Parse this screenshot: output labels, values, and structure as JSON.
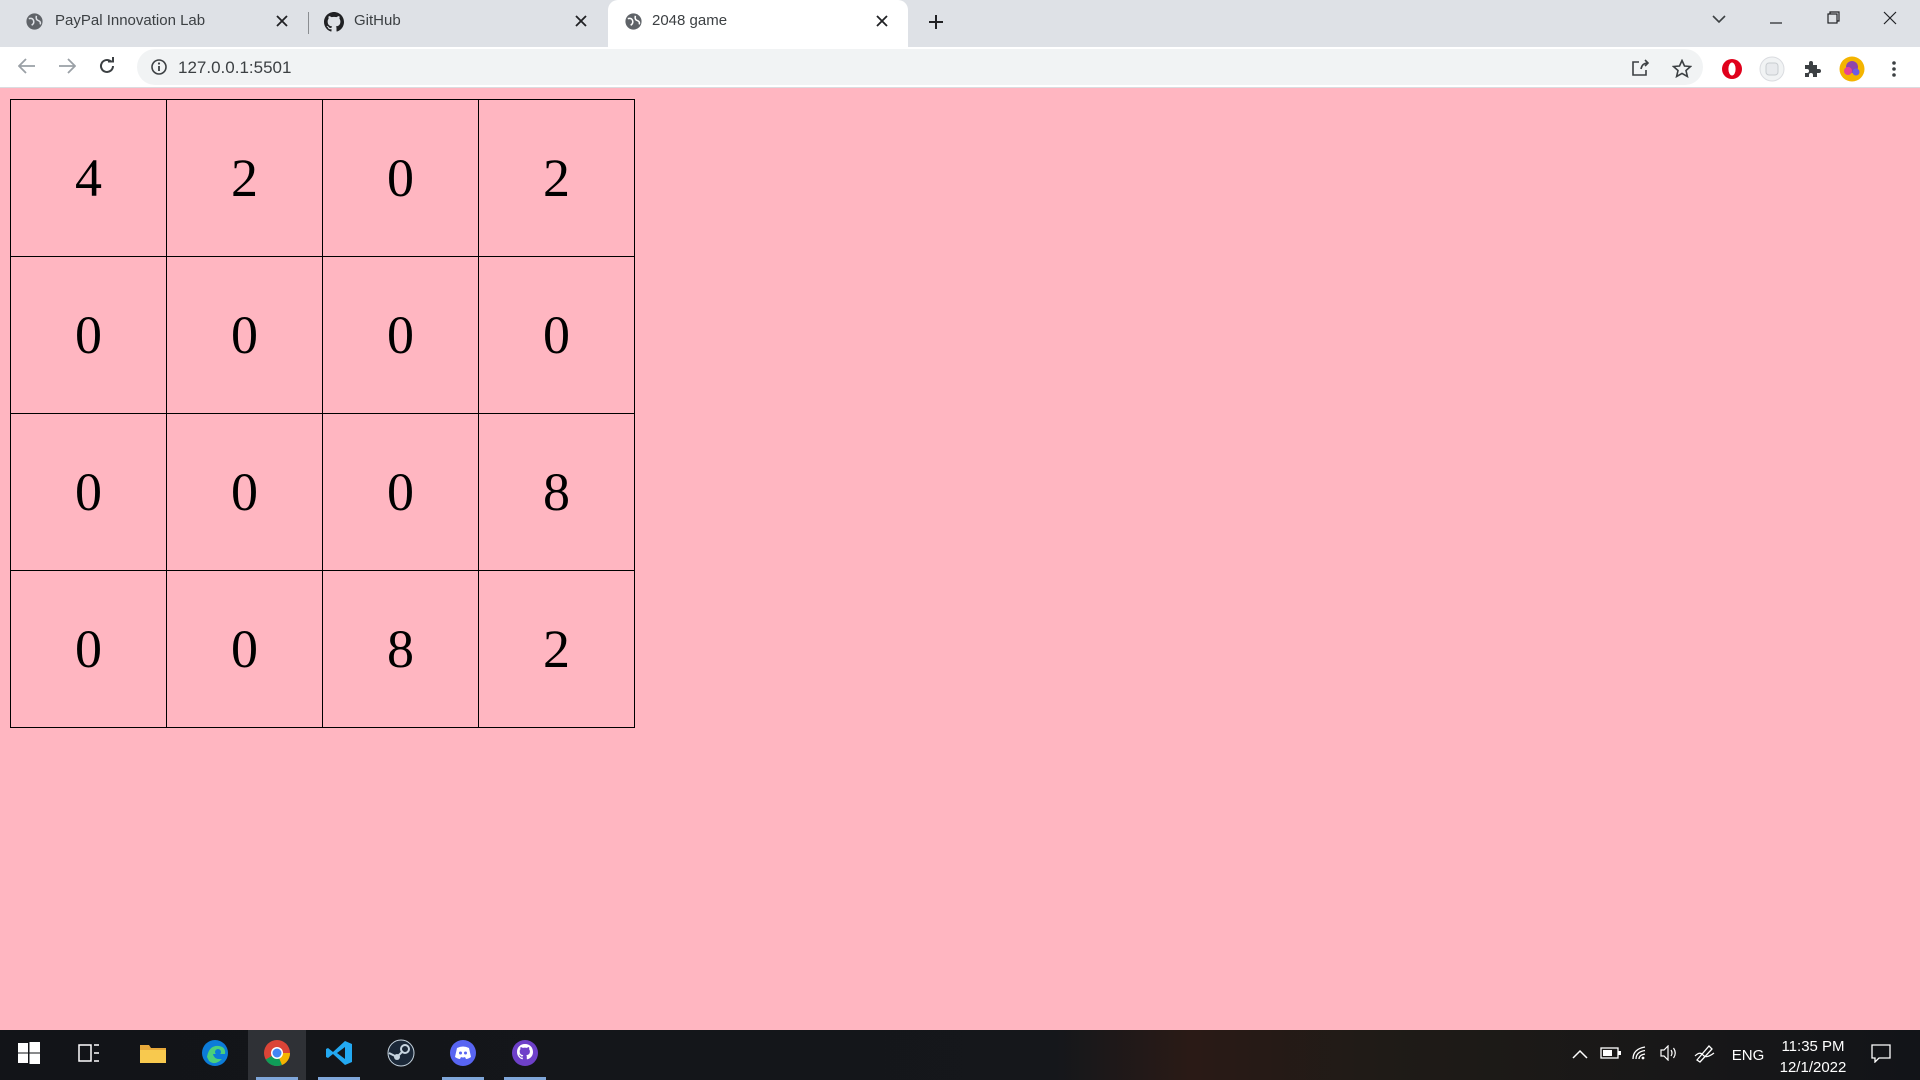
{
  "browser": {
    "tabs": [
      {
        "title": "PayPal Innovation Lab",
        "icon": "globe-icon",
        "active": false
      },
      {
        "title": "GitHub",
        "icon": "github-icon",
        "active": false
      },
      {
        "title": "2048 game",
        "icon": "globe-icon",
        "active": true
      }
    ],
    "url": "127.0.0.1:5501"
  },
  "game": {
    "background": "#ffb6c1",
    "grid": [
      [
        "4",
        "2",
        "0",
        "2"
      ],
      [
        "0",
        "0",
        "0",
        "0"
      ],
      [
        "0",
        "0",
        "0",
        "8"
      ],
      [
        "0",
        "0",
        "8",
        "2"
      ]
    ]
  },
  "taskbar": {
    "apps": [
      "windows-start-icon",
      "task-view-icon",
      "file-explorer-icon",
      "edge-icon",
      "chrome-icon",
      "vscode-icon",
      "steam-icon",
      "discord-icon",
      "github-desktop-icon"
    ],
    "language": "ENG",
    "time": "11:35 PM",
    "date": "12/1/2022"
  }
}
